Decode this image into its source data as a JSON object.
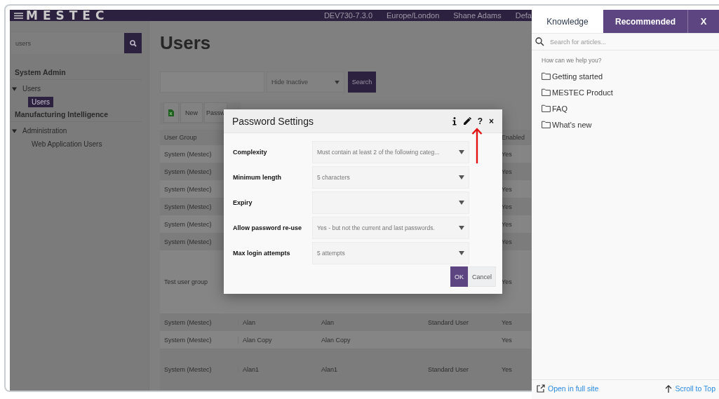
{
  "top_bar": {
    "logo": "MESTEC",
    "items": [
      "DEV730-7.3.0",
      "Europe/London",
      "Shane Adams",
      "Defa"
    ]
  },
  "sidebar": {
    "search": {
      "value": "users"
    },
    "items": [
      {
        "label": "System Admin",
        "kind": "heading",
        "children": [
          {
            "label": "Users",
            "expanded": true,
            "selected": false,
            "children": [
              {
                "label": "Users",
                "selected": true
              }
            ]
          }
        ]
      },
      {
        "label": "Manufacturing Intelligence",
        "kind": "heading",
        "children": [
          {
            "label": "Administration",
            "expanded": true,
            "selected": false,
            "children": [
              {
                "label": "Web Application Users",
                "selected": false
              }
            ]
          }
        ]
      }
    ]
  },
  "page": {
    "title": "Users",
    "filter": {
      "select": "Hide Inactive",
      "button": "Search"
    },
    "toolbar": [
      "New",
      "Passw"
    ],
    "table": {
      "columns": {
        "user_group": "User Group",
        "enabled": "Enabled"
      },
      "rows": [
        {
          "user_group": "System (Mestec)",
          "enabled": "Yes"
        },
        {
          "user_group": "System (Mestec)",
          "enabled": "Yes"
        },
        {
          "user_group": "System (Mestec)",
          "enabled": "Yes"
        },
        {
          "user_group": "System (Mestec)",
          "enabled": "Yes"
        },
        {
          "user_group": "System (Mestec)",
          "enabled": "Yes"
        },
        {
          "user_group": "System (Mestec)",
          "enabled": "Yes"
        },
        {
          "user_group": "Test user group",
          "enabled": "Yes"
        },
        {
          "user_group": "System (Mestec)",
          "column_2": "Alan",
          "column_3": "Alan",
          "column_4": "Standard User",
          "enabled": "Yes"
        },
        {
          "user_group": "System (Mestec)",
          "column_2": "Alan Copy",
          "column_3": "Alan Copy",
          "enabled": "Yes"
        },
        {
          "user_group": "System (Mestec)",
          "column_2": "Alan1",
          "column_3": "Alan1",
          "column_4": "Standard User",
          "enabled": "Yes"
        }
      ]
    }
  },
  "dialog": {
    "title": "Password Settings",
    "help_glyph": "?",
    "close_glyph": "×",
    "fields": [
      {
        "label": "Complexity",
        "value": "Must contain at least 2 of the following categ..."
      },
      {
        "label": "Minimum length",
        "value": "5 characters"
      },
      {
        "label": "Expiry"
      },
      {
        "label": "Allow password re-use",
        "value": "Yes - but not the current and last passwords."
      },
      {
        "label": "Max login attempts",
        "value": "5 attempts"
      }
    ],
    "buttons": [
      {
        "label": "OK",
        "kind": "primary"
      },
      {
        "label": "Cancel",
        "kind": "secondary"
      }
    ]
  },
  "help_panel": {
    "tabs": [
      {
        "label": "Knowledge",
        "selected": true
      },
      {
        "label": "Recommended",
        "selected": false
      }
    ],
    "close": "X",
    "search": {
      "placeholder": "Search for articles..."
    },
    "prompt": "How can we help you?",
    "folders": [
      "Getting started",
      "MESTEC Product",
      "FAQ",
      "What's new"
    ],
    "footer": {
      "open": "Open in full site",
      "scroll": "Scroll to Top"
    }
  }
}
